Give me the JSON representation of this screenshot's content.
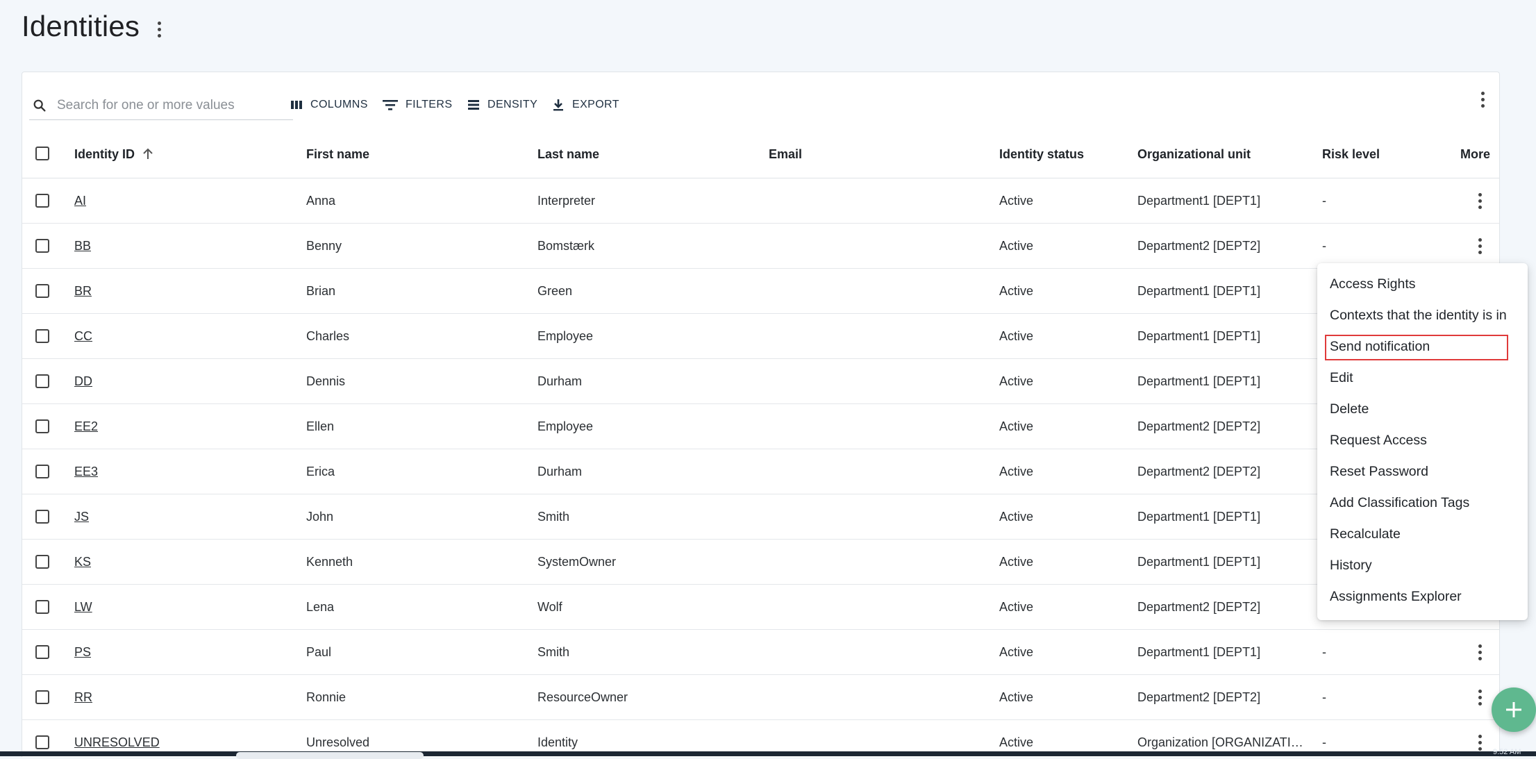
{
  "page": {
    "title": "Identities"
  },
  "toolbar": {
    "search_placeholder": "Search for one or more values",
    "columns_label": "COLUMNS",
    "filters_label": "FILTERS",
    "density_label": "DENSITY",
    "export_label": "EXPORT"
  },
  "table": {
    "headers": {
      "identity_id": "Identity ID",
      "first_name": "First name",
      "last_name": "Last name",
      "email": "Email",
      "identity_status": "Identity status",
      "organizational_unit": "Organizational unit",
      "risk_level": "Risk level",
      "more": "More"
    },
    "rows": [
      {
        "id": "AI",
        "first": "Anna",
        "last": "Interpreter",
        "email": "",
        "status": "Active",
        "org": "Department1 [DEPT1]",
        "risk": "-"
      },
      {
        "id": "BB",
        "first": "Benny",
        "last": "Bomstærk",
        "email": "",
        "status": "Active",
        "org": "Department2 [DEPT2]",
        "risk": "-"
      },
      {
        "id": "BR",
        "first": "Brian",
        "last": "Green",
        "email": "",
        "status": "Active",
        "org": "Department1 [DEPT1]",
        "risk": ""
      },
      {
        "id": "CC",
        "first": "Charles",
        "last": "Employee",
        "email": "",
        "status": "Active",
        "org": "Department1 [DEPT1]",
        "risk": ""
      },
      {
        "id": "DD",
        "first": "Dennis",
        "last": "Durham",
        "email": "",
        "status": "Active",
        "org": "Department1 [DEPT1]",
        "risk": ""
      },
      {
        "id": "EE2",
        "first": "Ellen",
        "last": "Employee",
        "email": "",
        "status": "Active",
        "org": "Department2 [DEPT2]",
        "risk": ""
      },
      {
        "id": "EE3",
        "first": "Erica",
        "last": "Durham",
        "email": "",
        "status": "Active",
        "org": "Department2 [DEPT2]",
        "risk": ""
      },
      {
        "id": "JS",
        "first": "John",
        "last": "Smith",
        "email": "",
        "status": "Active",
        "org": "Department1 [DEPT1]",
        "risk": ""
      },
      {
        "id": "KS",
        "first": "Kenneth",
        "last": "SystemOwner",
        "email": "",
        "status": "Active",
        "org": "Department1 [DEPT1]",
        "risk": ""
      },
      {
        "id": "LW",
        "first": "Lena",
        "last": "Wolf",
        "email": "",
        "status": "Active",
        "org": "Department2 [DEPT2]",
        "risk": ""
      },
      {
        "id": "PS",
        "first": "Paul",
        "last": "Smith",
        "email": "",
        "status": "Active",
        "org": "Department1 [DEPT1]",
        "risk": "-"
      },
      {
        "id": "RR",
        "first": "Ronnie",
        "last": "ResourceOwner",
        "email": "",
        "status": "Active",
        "org": "Department2 [DEPT2]",
        "risk": "-"
      },
      {
        "id": "UNRESOLVED",
        "first": "Unresolved",
        "last": "Identity",
        "email": "",
        "status": "Active",
        "org": "Organization [ORGANIZATI…",
        "risk": "-"
      }
    ]
  },
  "context_menu": {
    "items": [
      "Access Rights",
      "Contexts that the identity is in",
      "Send notification",
      "Edit",
      "Delete",
      "Request Access",
      "Reset Password",
      "Add Classification Tags",
      "Recalculate",
      "History",
      "Assignments Explorer"
    ],
    "highlighted": "Send notification"
  },
  "fab": {
    "label": "+"
  },
  "taskbar": {
    "time": "9:52 AM"
  },
  "colors": {
    "accent": "#5fb88f",
    "highlight_border": "#e03a3a",
    "background": "#f3f7fb"
  },
  "icons": {
    "search": "search-icon",
    "columns": "columns-icon",
    "filters": "filter-icon",
    "density": "density-icon",
    "export": "download-icon",
    "more": "more-vertical-icon",
    "sort": "arrow-up-icon",
    "add": "plus-icon"
  }
}
